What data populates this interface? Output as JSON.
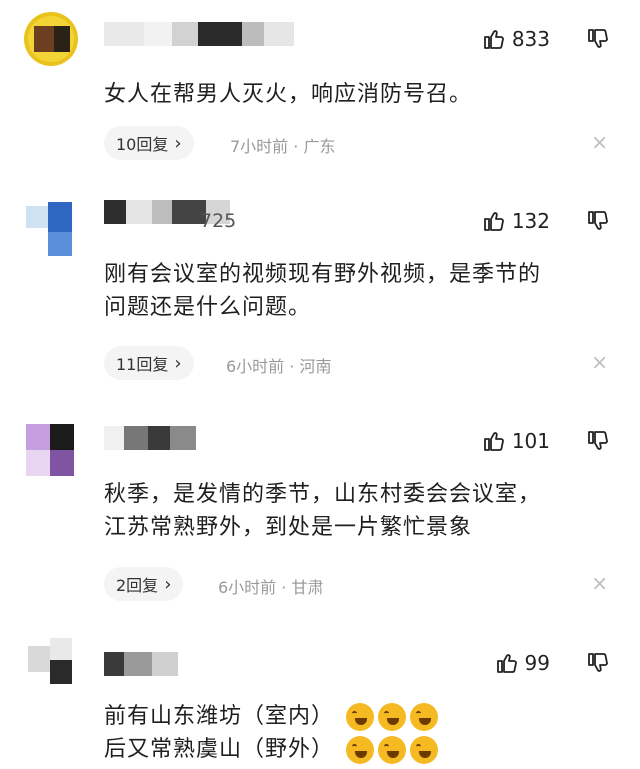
{
  "comments": [
    {
      "username": "",
      "likes": "833",
      "text": "女人在帮男人灭火，响应消防号召。",
      "reply_label": "10回复",
      "time": "7小时前",
      "location": "广东"
    },
    {
      "username": "725",
      "likes": "132",
      "text_line1": "刚有会议室的视频现有野外视频，是季节的",
      "text_line2": "问题还是什么问题。",
      "reply_label": "11回复",
      "time": "6小时前",
      "location": "河南"
    },
    {
      "username": "",
      "likes": "101",
      "text_line1": "秋季，是发情的季节，山东村委会会议室，",
      "text_line2": "江苏常熟野外，到处是一片繁忙景象",
      "reply_label": "2回复",
      "time": "6小时前",
      "location": "甘肃"
    },
    {
      "username": "",
      "likes": "99",
      "text_line1": "前有山东潍坊（室内）",
      "text_line2": "后又常熟虞山（野外）"
    }
  ],
  "icons": {
    "like": "thumbs-up-icon",
    "dislike": "thumbs-down-icon",
    "close": "close-icon",
    "emoji": "laughing-emoji-icon"
  },
  "separator": " · ",
  "reply_arrow": "›",
  "close_glyph": "×"
}
